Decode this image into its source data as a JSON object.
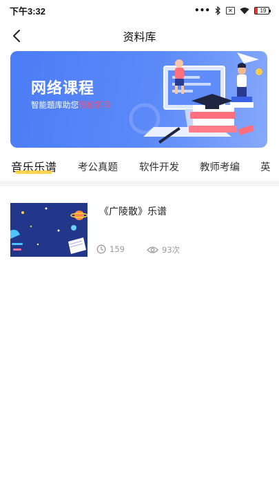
{
  "status_bar": {
    "time": "下午3:32",
    "dots": "•••",
    "sim_label": "✕",
    "battery": "19",
    "icons": [
      "bluetooth-icon",
      "sim-x-icon",
      "wifi-icon",
      "battery-icon"
    ]
  },
  "nav": {
    "title": "资料库",
    "back_icon": "chevron-left-icon"
  },
  "banner": {
    "title": "网络课程",
    "subtitle_prefix": "智能题库助您",
    "subtitle_highlight": "轻松学习",
    "colors": {
      "background": "#4c7cf6",
      "highlight": "#ff4d6d"
    }
  },
  "tabs": [
    {
      "label": "音乐乐谱",
      "active": true
    },
    {
      "label": "考公真题",
      "active": false
    },
    {
      "label": "软件开发",
      "active": false
    },
    {
      "label": "教师考编",
      "active": false
    },
    {
      "label": "英",
      "active": false
    }
  ],
  "tab_indicator_color": "#ffd23f",
  "items": [
    {
      "title": "《广陵散》乐谱",
      "time_value": "159",
      "views_value": "93次",
      "time_icon": "clock-icon",
      "views_icon": "eye-icon"
    }
  ]
}
